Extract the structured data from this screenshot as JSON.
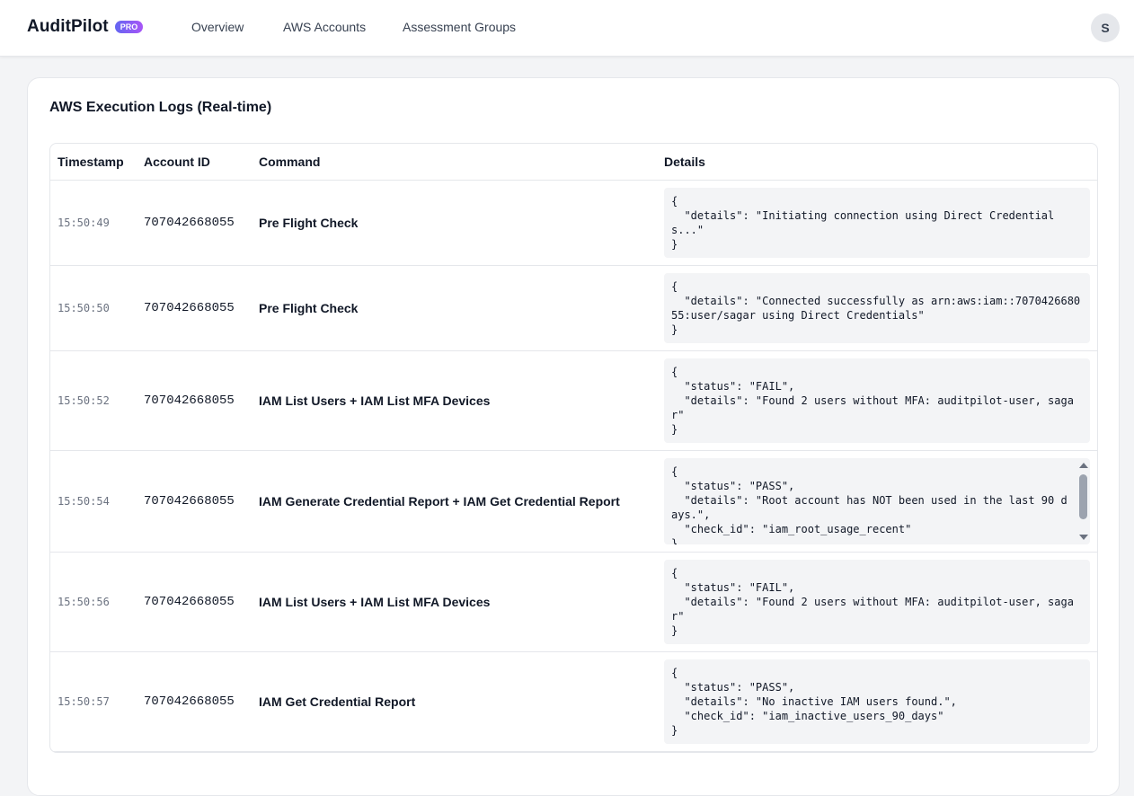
{
  "header": {
    "brand": "AuditPilot",
    "badge": "PRO",
    "nav": [
      "Overview",
      "AWS Accounts",
      "Assessment Groups"
    ],
    "avatar_initial": "S"
  },
  "logs": {
    "title": "AWS Execution Logs (Real-time)",
    "columns": [
      "Timestamp",
      "Account ID",
      "Command",
      "Details"
    ],
    "rows": [
      {
        "timestamp": "15:50:49",
        "account": "707042668055",
        "command": "Pre Flight Check",
        "details": "{\n  \"details\": \"Initiating connection using Direct Credentials...\"\n}"
      },
      {
        "timestamp": "15:50:50",
        "account": "707042668055",
        "command": "Pre Flight Check",
        "details": "{\n  \"details\": \"Connected successfully as arn:aws:iam::707042668055:user/sagar using Direct Credentials\"\n}"
      },
      {
        "timestamp": "15:50:52",
        "account": "707042668055",
        "command": "IAM List Users + IAM List MFA Devices",
        "details": "{\n  \"status\": \"FAIL\",\n  \"details\": \"Found 2 users without MFA: auditpilot-user, sagar\"\n}"
      },
      {
        "timestamp": "15:50:54",
        "account": "707042668055",
        "command": "IAM Generate Credential Report + IAM Get Credential Report",
        "details": "{\n  \"status\": \"PASS\",\n  \"details\": \"Root account has NOT been used in the last 90 days.\",\n  \"check_id\": \"iam_root_usage_recent\"\n}"
      },
      {
        "timestamp": "15:50:56",
        "account": "707042668055",
        "command": "IAM List Users + IAM List MFA Devices",
        "details": "{\n  \"status\": \"FAIL\",\n  \"details\": \"Found 2 users without MFA: auditpilot-user, sagar\"\n}"
      },
      {
        "timestamp": "15:50:57",
        "account": "707042668055",
        "command": "IAM Get Credential Report",
        "details": "{\n  \"status\": \"PASS\",\n  \"details\": \"No inactive IAM users found.\",\n  \"check_id\": \"iam_inactive_users_90_days\"\n}"
      }
    ]
  }
}
